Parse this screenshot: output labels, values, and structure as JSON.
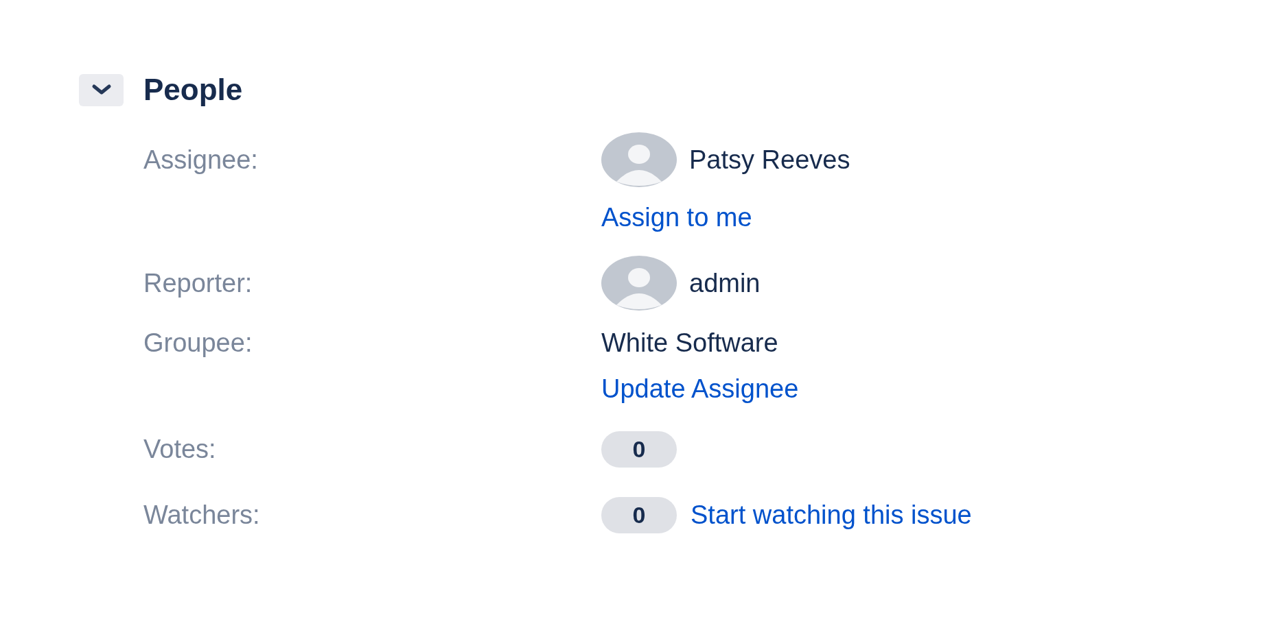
{
  "section": {
    "title": "People",
    "expanded": true
  },
  "rows": [
    {
      "kind": "user",
      "label": "Assignee:",
      "value": "Patsy Reeves",
      "action": "Assign to me"
    },
    {
      "kind": "user",
      "label": "Reporter:",
      "value": "admin"
    },
    {
      "kind": "text",
      "label": "Groupee:",
      "value": "White Software",
      "action": "Update Assignee"
    },
    {
      "kind": "count",
      "label": "Votes:",
      "value": "0"
    },
    {
      "kind": "count",
      "label": "Watchers:",
      "value": "0",
      "action": "Start watching this issue"
    }
  ]
}
